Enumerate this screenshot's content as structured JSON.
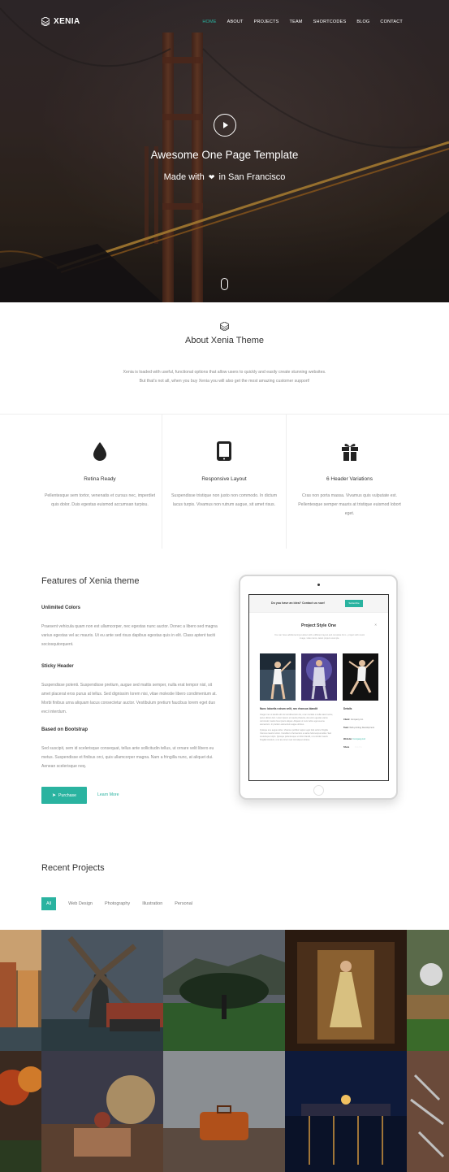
{
  "brand": "XENIA",
  "nav": [
    "HOME",
    "ABOUT",
    "PROJECTS",
    "TEAM",
    "SHORTCODES",
    "BLOG",
    "CONTACT"
  ],
  "hero": {
    "title": "Awesome One Page Template",
    "subtitle_before": "Made with",
    "subtitle_after": "in San Francisco"
  },
  "about": {
    "title": "About Xenia Theme",
    "line1": "Xenia is loaded with useful, functional options that allow users to quickly and easily create stunning websites.",
    "line2": "But that's not all, when you buy Xenia you will also get the most amazing customer support!"
  },
  "features_row": [
    {
      "icon": "drop-icon",
      "title": "Retina Ready",
      "text": "Pellentesque sem tortor, venenatis et cursus nec, imperdiet quis dolor. Duis egestas euismod accumsan turpisu."
    },
    {
      "icon": "tablet-icon",
      "title": "Responsive Layout",
      "text": "Suspendisse tristique non justo non commodo. In dictum lacus turpis. Vivamus non rutrum augue, sit amet risus."
    },
    {
      "icon": "gift-icon",
      "title": "6 Header Variations",
      "text": "Cras non porta massa. Vivamus quis vulputate est. Pellentesque semper mauris at tristique euismod lobort eget."
    }
  ],
  "features": {
    "title": "Features of Xenia theme",
    "items": [
      {
        "title": "Unlimited Colors",
        "text": "Praesent vehicula quam non est ullamcorper, nec egestas nunc auctor. Donec a libero sed magna varius egestas vel ac mauris. Ut eu ante sed risus dapibus egestas quis in elit. Class aptent taciti sociosqutorquent."
      },
      {
        "title": "Sticky Header",
        "text": "Suspendisse potenti. Suspendisse pretium, augue sed mattis semper, nulla erat tempor nisl, sit amet placerat eros purus at tellus. Sed dignissim lorem nisi, vitae molestie libero condimentum at. Morbi finibus urna aliquam lacus consectetur auctor. Vestibulum pretium faucibus lorem eget duo evci interdum."
      },
      {
        "title": "Based on Bootstrap",
        "text": "Sed suscipit, sem id scelerisque consequat, tellus ante sollicitudin tellus, ut ornare velit libero eu metus. Suspendisse et finibus orci, quis ullamcorper magna. Nam a fringilla nunc, at aliquet dui. Aenean scelerisque neq."
      }
    ],
    "purchase": "Purchase",
    "learn_more": "Learn More"
  },
  "tablet": {
    "bar_text": "Do you have an idea? Contact us now!",
    "bar_button": "Subscribe",
    "project_title": "Project Style One",
    "project_sub": "You can have additional input about with a different layout and complete form - project with music image, video items, latest project example.",
    "name": "Nunc lobortis rutrum velit, nec rhoncus blandit",
    "desc": "Integer nec ut iaculis elit nisl condimentum dui, ut ac mentias a nulla wasnt some, purus dictum fem. Lorem ipsum et mauris pharetra, dui enim egestas varius commodo, fuacis risus ipsum aliquet. Aliquam ut nunc tellus eget eueme elementum. In pretium elementum augue ultrices.",
    "desc2": "Quisque at a augue tellus. Vivamus porttitor sapien eget felis vehicu fringilla rhoncus mauris rutrum. Curabitur ut fermentum a varius felis tempus tellus. Sed scelerisque turpis. Quisque pellentesque ut dolor blandit, ut a similar mauris fringilla tincidunt, ut et are lorem sed nisi aliquet ultrices.",
    "details_title": "Details",
    "details": [
      {
        "label": "Client:",
        "value": "Company Inc."
      },
      {
        "label": "Task:",
        "value": "Web-printing Development"
      },
      {
        "label": "Website:",
        "value": "Company.Ltd"
      }
    ],
    "share": "Share"
  },
  "projects": {
    "title": "Recent Projects",
    "filters": [
      "All",
      "Web Design",
      "Photography",
      "Illustration",
      "Personal"
    ]
  }
}
